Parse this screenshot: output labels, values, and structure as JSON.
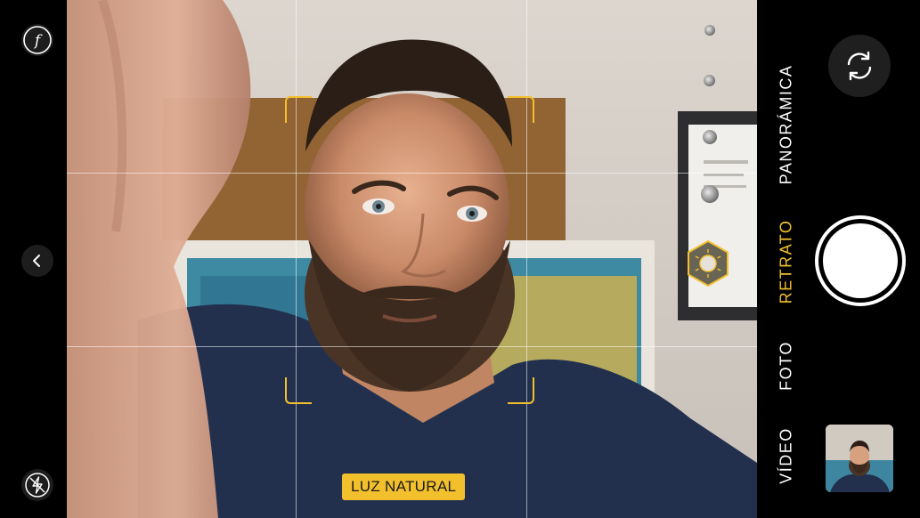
{
  "camera": {
    "modes": [
      {
        "label": "VÍDEO",
        "active": false
      },
      {
        "label": "FOTO",
        "active": false
      },
      {
        "label": "RETRATO",
        "active": true
      },
      {
        "label": "PANORÁMICA",
        "active": false
      }
    ],
    "portrait_lighting": {
      "label": "LUZ NATURAL",
      "selected_index": 1,
      "options_count": 6
    },
    "left_controls": {
      "aperture_symbol": "f",
      "icons": [
        "aperture-icon",
        "chevron-left-icon",
        "flash-off-icon"
      ]
    },
    "right_controls": {
      "icons": [
        "camera-flip-icon",
        "shutter-button",
        "last-photo-thumbnail"
      ]
    }
  },
  "colors": {
    "accent": "#f2c02d",
    "background": "#000000",
    "grid": "#ffffff",
    "shirt": "#22304e"
  }
}
